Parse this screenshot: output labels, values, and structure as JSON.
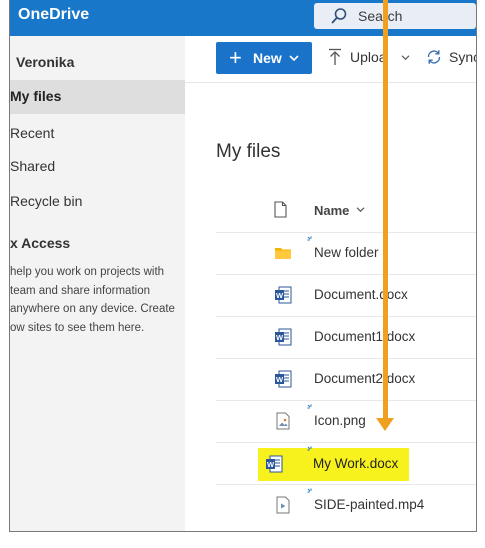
{
  "app": {
    "brand": "OneDrive"
  },
  "search": {
    "label": "Search"
  },
  "sidebar": {
    "user_name": "Veronika",
    "items": [
      {
        "label": "My files",
        "selected": true
      },
      {
        "label": "Recent",
        "selected": false
      },
      {
        "label": "Shared",
        "selected": false
      },
      {
        "label": "Recycle bin",
        "selected": false
      }
    ],
    "quick_access_title": "x Access",
    "quick_access_lines": [
      "help you work on projects with",
      "team and share information",
      "anywhere on any device. Create",
      "ow sites to see them here."
    ]
  },
  "toolbar": {
    "new_label": "New",
    "upload_label": "Uploa",
    "sync_label": "Sync"
  },
  "main": {
    "title": "My files",
    "name_header": "Name"
  },
  "files": [
    {
      "name": "New folder",
      "icon": "folder-icon",
      "is_new": true
    },
    {
      "name": "Document.docx",
      "icon": "word-doc-icon",
      "is_new": false
    },
    {
      "name": "Document1.docx",
      "icon": "word-doc-icon",
      "is_new": false
    },
    {
      "name": "Document2.docx",
      "icon": "word-doc-icon",
      "is_new": false
    },
    {
      "name": "Icon.png",
      "icon": "image-file-icon",
      "is_new": true
    },
    {
      "name": "My Work.docx",
      "icon": "word-doc-icon",
      "is_new": true
    },
    {
      "name": "SIDE-painted.mp4",
      "icon": "video-file-icon",
      "is_new": true
    }
  ],
  "colors": {
    "brand_blue": "#1877c9",
    "highlight_yellow": "#f7f21d",
    "arrow_orange": "#f0a020"
  }
}
